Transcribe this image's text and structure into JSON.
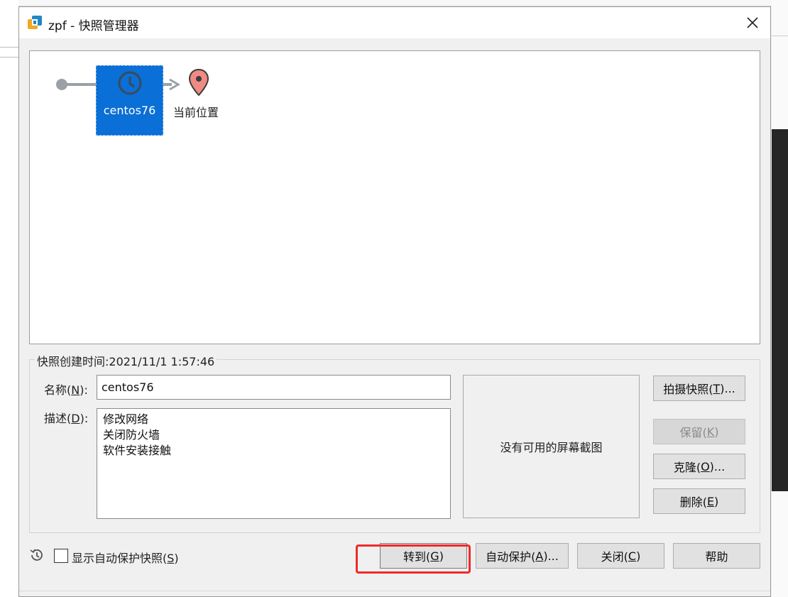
{
  "window": {
    "title": "zpf - 快照管理器"
  },
  "tree": {
    "snapshot_name": "centos76",
    "current_label": "当前位置"
  },
  "details": {
    "created_time": "快照创建时间:2021/11/1 1:57:46",
    "name_label_pre": "名称(",
    "name_key": "N",
    "name_label_post": "):",
    "name_value": "centos76",
    "desc_label_pre": "描述(",
    "desc_key": "D",
    "desc_label_post": "):",
    "desc_value": "修改网络\n关闭防火墙\n软件安装接触",
    "no_screenshot": "没有可用的屏幕截图"
  },
  "side_buttons": {
    "take": {
      "pre": "拍摄快照(",
      "key": "T",
      "post": ")..."
    },
    "keep": {
      "pre": "保留(",
      "key": "K",
      "post": ")"
    },
    "clone": {
      "pre": "克隆(",
      "key": "O",
      "post": ")..."
    },
    "delete": {
      "pre": "删除(",
      "key": "E",
      "post": ")"
    }
  },
  "footer": {
    "show_auto_pre": "显示自动保护快照(",
    "show_auto_key": "S",
    "show_auto_post": ")",
    "goto": {
      "pre": "转到(",
      "key": "G",
      "post": ")"
    },
    "autoprotect": {
      "pre": "自动保护(",
      "key": "A",
      "post": ")..."
    },
    "close": {
      "pre": "关闭(",
      "key": "C",
      "post": ")"
    },
    "help": "帮助"
  },
  "colors": {
    "selected_node": "#0a6fd6",
    "pin": "#f08a84",
    "highlight": "#ee2a2a"
  },
  "icons": [
    "app-icon",
    "close-icon",
    "clock-icon",
    "location-pin-icon",
    "history-icon"
  ]
}
